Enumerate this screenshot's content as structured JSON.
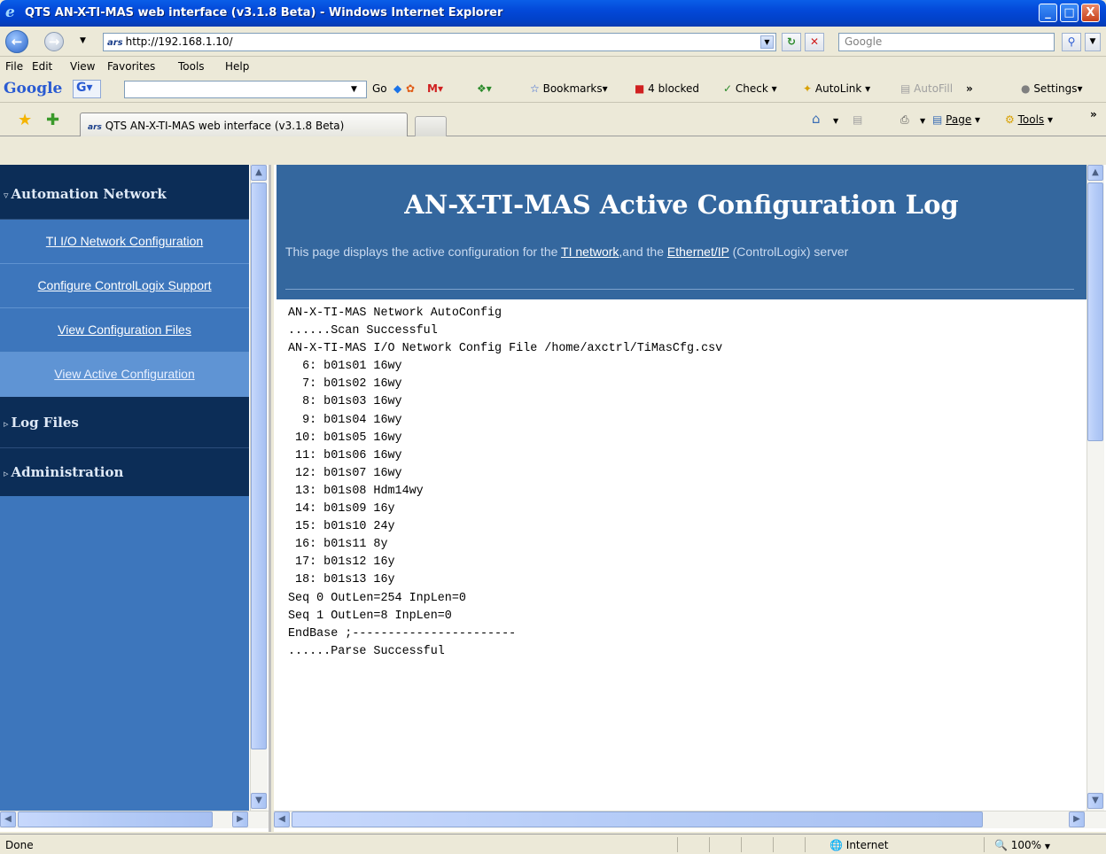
{
  "window": {
    "title": "QTS AN-X-TI-MAS web interface (v3.1.8 Beta) - Windows Internet Explorer",
    "controls": [
      "_",
      "□",
      "X"
    ]
  },
  "address_bar": {
    "url": "http://192.168.1.10/",
    "site_icon": "ars",
    "search_placeholder": "Google"
  },
  "menu": {
    "items": [
      "File",
      "Edit",
      "View",
      "Favorites",
      "Tools",
      "Help"
    ]
  },
  "google_toolbar": {
    "logo": "Google",
    "go": "Go",
    "bookmarks": "Bookmarks",
    "blocked": "4 blocked",
    "check": "Check",
    "autolink": "AutoLink",
    "autofill": "AutoFill",
    "more": "»",
    "settings": "Settings"
  },
  "tabs": {
    "active_title": "QTS AN-X-TI-MAS web interface (v3.1.8 Beta)",
    "commands": {
      "page": "Page",
      "tools": "Tools",
      "more": "»"
    }
  },
  "sidebar": {
    "sections": [
      {
        "label": "Automation Network",
        "expanded": true
      },
      {
        "label": "Log Files",
        "expanded": false
      },
      {
        "label": "Administration",
        "expanded": false
      }
    ],
    "items": [
      {
        "label": "TI I/O Network Configuration"
      },
      {
        "label": "Configure ControlLogix Support"
      },
      {
        "label": "View Configuration Files"
      },
      {
        "label": "View Active Configuration",
        "active": true
      }
    ]
  },
  "main": {
    "heading": "AN-X-TI-MAS Active Configuration Log",
    "description_prefix": "This page displays the active configuration for the ",
    "link_ti": "TI network",
    "description_middle": ",and the ",
    "link_eip": "Ethernet/IP",
    "description_suffix": " (ControlLogix) server",
    "log_lines": [
      "AN-X-TI-MAS Network AutoConfig",
      "......Scan Successful",
      "AN-X-TI-MAS I/O Network Config File /home/axctrl/TiMasCfg.csv",
      "  6: b01s01 16wy",
      "  7: b01s02 16wy",
      "  8: b01s03 16wy",
      "  9: b01s04 16wy",
      " 10: b01s05 16wy",
      " 11: b01s06 16wy",
      " 12: b01s07 16wy",
      " 13: b01s08 Hdm14wy",
      " 14: b01s09 16y",
      " 15: b01s10 24y",
      " 16: b01s11 8y",
      " 17: b01s12 16y",
      " 18: b01s13 16y",
      "Seq 0 OutLen=254 InpLen=0",
      "Seq 1 OutLen=8 InpLen=0",
      "EndBase ;-----------------------",
      "......Parse Successful"
    ]
  },
  "status_bar": {
    "status": "Done",
    "zone": "Internet",
    "zoom": "100%"
  },
  "colors": {
    "title_bar": "#0348d8",
    "sidebar_dark": "#0c2d57",
    "sidebar_light": "#3d76bc",
    "header_blue": "#34679e"
  }
}
